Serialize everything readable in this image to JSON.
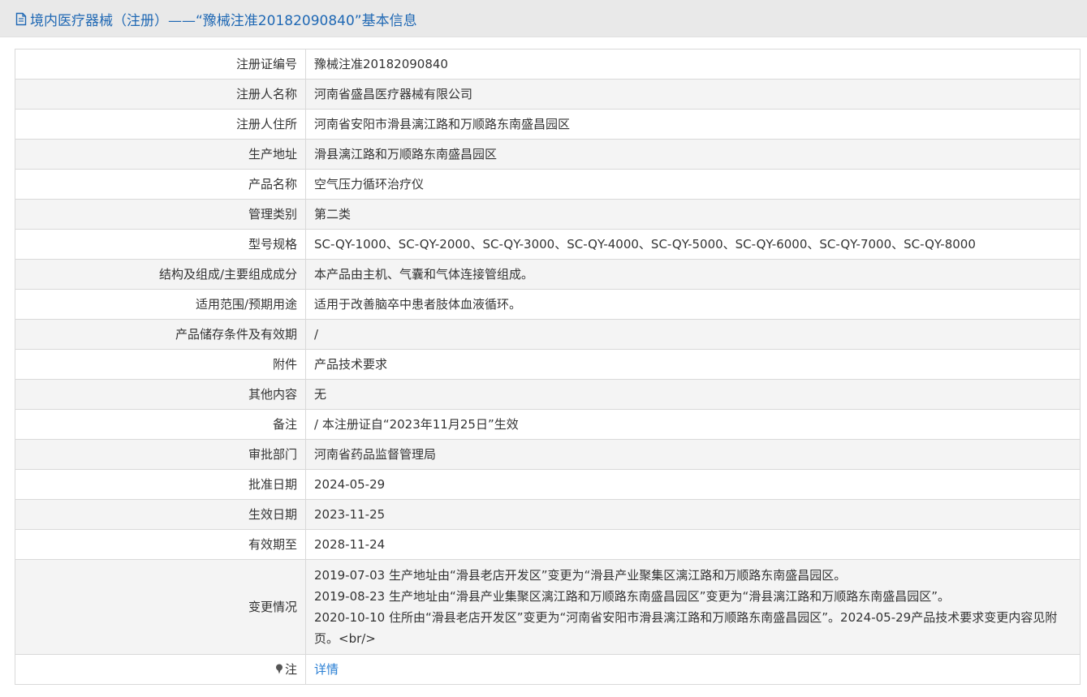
{
  "header": {
    "icon": "document-icon",
    "title": "境内医疗器械（注册）——“豫械注准20182090840”基本信息"
  },
  "rows": [
    {
      "label": "注册证编号",
      "value": "豫械注准20182090840"
    },
    {
      "label": "注册人名称",
      "value": "河南省盛昌医疗器械有限公司"
    },
    {
      "label": "注册人住所",
      "value": "河南省安阳市滑县漓江路和万顺路东南盛昌园区"
    },
    {
      "label": "生产地址",
      "value": "滑县漓江路和万顺路东南盛昌园区"
    },
    {
      "label": "产品名称",
      "value": "空气压力循环治疗仪"
    },
    {
      "label": "管理类别",
      "value": "第二类"
    },
    {
      "label": "型号规格",
      "value": "SC-QY-1000、SC-QY-2000、SC-QY-3000、SC-QY-4000、SC-QY-5000、SC-QY-6000、SC-QY-7000、SC-QY-8000"
    },
    {
      "label": "结构及组成/主要组成成分",
      "value": "本产品由主机、气囊和气体连接管组成。"
    },
    {
      "label": "适用范围/预期用途",
      "value": "适用于改善脑卒中患者肢体血液循环。"
    },
    {
      "label": "产品储存条件及有效期",
      "value": "/"
    },
    {
      "label": "附件",
      "value": "产品技术要求"
    },
    {
      "label": "其他内容",
      "value": "无"
    },
    {
      "label": "备注",
      "value": "/ 本注册证自“2023年11月25日”生效"
    },
    {
      "label": "审批部门",
      "value": "河南省药品监督管理局"
    },
    {
      "label": "批准日期",
      "value": "2024-05-29"
    },
    {
      "label": "生效日期",
      "value": "2023-11-25"
    },
    {
      "label": "有效期至",
      "value": "2028-11-24"
    }
  ],
  "changes": {
    "label": "变更情况",
    "lines": [
      "2019-07-03 生产地址由“滑县老店开发区”变更为“滑县产业聚集区漓江路和万顺路东南盛昌园区。",
      "2019-08-23 生产地址由“滑县产业集聚区漓江路和万顺路东南盛昌园区”变更为“滑县漓江路和万顺路东南盛昌园区”。",
      "2020-10-10 住所由“滑县老店开发区”变更为“河南省安阳市滑县漓江路和万顺路东南盛昌园区”。2024-05-29产品技术要求变更内容见附页。<br/>"
    ]
  },
  "note": {
    "icon": "pin-icon",
    "label": "注",
    "link_text": "详情"
  }
}
